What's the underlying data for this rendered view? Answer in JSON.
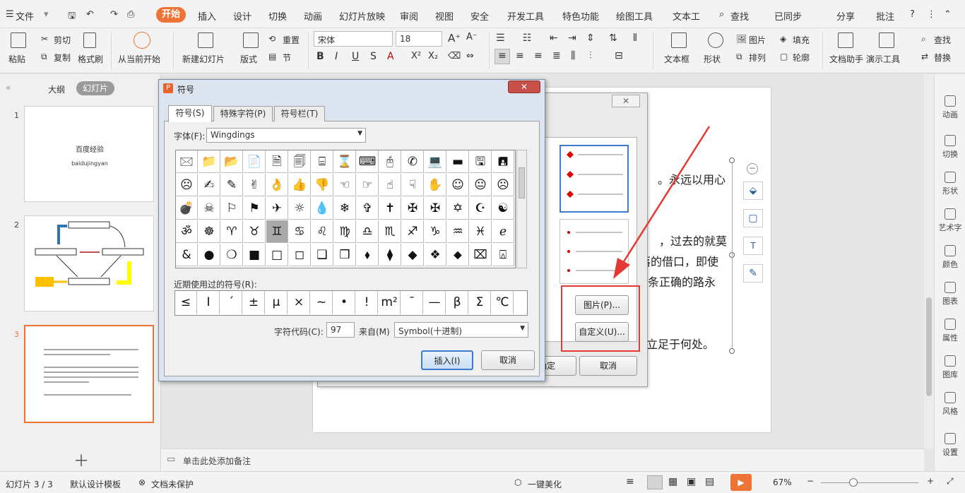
{
  "menubar": {
    "file": "文件",
    "start": "开始",
    "tabs": [
      "插入",
      "设计",
      "切换",
      "动画",
      "幻灯片放映",
      "审阅",
      "视图",
      "安全",
      "开发工具",
      "特色功能",
      "绘图工具",
      "文本工"
    ],
    "search": "查找",
    "synced": "已同步",
    "share": "分享",
    "comment": "批注"
  },
  "ribbon": {
    "paste": "粘贴",
    "cut": "剪切",
    "copy": "复制",
    "format_painter": "格式刷",
    "from_current": "从当前开始",
    "new_slide": "新建幻灯片",
    "layout": "版式",
    "reset": "重置",
    "section": "节",
    "font_name": "宋体",
    "font_size": "18",
    "textbox": "文本框",
    "shape": "形状",
    "picture": "图片",
    "fill": "填充",
    "arrange": "排列",
    "outline": "轮廓",
    "doc_helper": "文档助手",
    "presentation_tool": "演示工具",
    "find": "查找",
    "replace": "替换"
  },
  "left_panel": {
    "tab_outline": "大纲",
    "tab_slides": "幻灯片",
    "slide_numbers": [
      "1",
      "2",
      "3"
    ],
    "slide1_title": "百度经验",
    "slide1_subtitle": "baidujingyan",
    "add_icon": "plus-icon"
  },
  "slide_text": [
    "。永远以用心",
    "，过去的就莫",
    "落的借口，即使",
    "条正确的路永",
    "立足于何处。"
  ],
  "bullet_dialog": {
    "picture_btn": "图片(P)...",
    "custom_btn": "自定义(U)...",
    "ok_btn": "确定",
    "cancel_btn": "取消"
  },
  "symbol_dialog": {
    "title": "符号",
    "tabs": [
      "符号(S)",
      "特殊字符(P)",
      "符号栏(T)"
    ],
    "font_label": "字体(F):",
    "font_value": "Wingdings",
    "recent_label": "近期使用过的符号(R):",
    "recent": [
      "≤",
      "Ι",
      "´",
      "±",
      "μ",
      "×",
      "~",
      "•",
      "!",
      "m²",
      "¯",
      "—",
      "β",
      "Σ",
      "℃"
    ],
    "char_code_label": "字符代码(C):",
    "char_code": "97",
    "from_label": "来自(M)",
    "from_value": "Symbol(十进制)",
    "insert_btn": "插入(I)",
    "cancel_btn": "取消",
    "glyphs": [
      "🖂",
      "📁",
      "📂",
      "📄",
      "🗎",
      "🗐",
      "⌸",
      "⌛",
      "⌨",
      "🖰",
      "✆",
      "💻",
      "▬",
      "🖫",
      "🖪",
      "☹",
      "✍",
      "✎",
      "✌",
      "👌",
      "👍",
      "👎",
      "☜",
      "☞",
      "☝",
      "☟",
      "✋",
      "☺",
      "😐",
      "☹",
      "💣",
      "☠",
      "⚐",
      "⚑",
      "✈",
      "☼",
      "💧",
      "❄",
      "✞",
      "✝",
      "✠",
      "✠",
      "✡",
      "☪",
      "☯",
      "ॐ",
      "☸",
      "♈",
      "♉",
      "♊",
      "♋",
      "♌",
      "♍",
      "♎",
      "♏",
      "♐",
      "♑",
      "♒",
      "♓",
      "ℯ",
      "&",
      "●",
      "❍",
      "■",
      "□",
      "◻",
      "❑",
      "❒",
      "⬧",
      "⧫",
      "◆",
      "❖",
      "⬥",
      "⌧",
      "⍓"
    ]
  },
  "right_toolbar": [
    "动画",
    "切换",
    "形状",
    "艺术字",
    "颜色",
    "图表",
    "属性",
    "图库",
    "风格",
    "设置"
  ],
  "notes": {
    "placeholder": "单击此处添加备注"
  },
  "statusbar": {
    "slide_info": "幻灯片 3 / 3",
    "template": "默认设计模板",
    "protection": "文档未保护",
    "beautify": "一键美化",
    "zoom": "67%"
  },
  "colors": {
    "accent": "#f07336",
    "highlight_red": "#e53935"
  }
}
